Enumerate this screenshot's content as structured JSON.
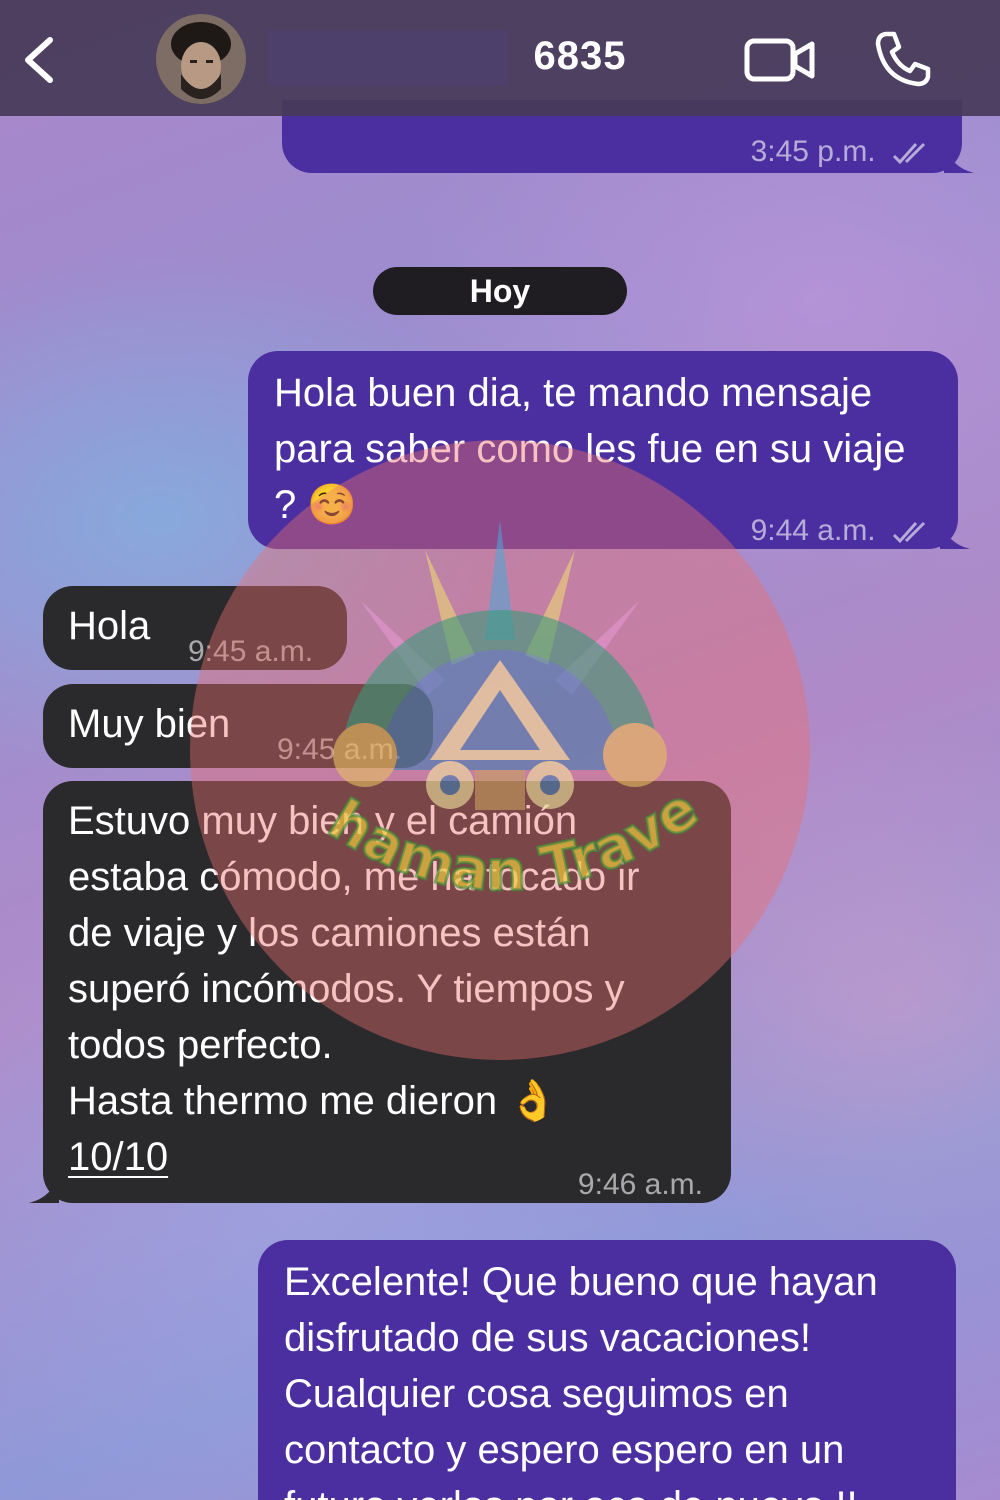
{
  "header": {
    "contact_name": "6835",
    "back_icon": "chevron-left-icon",
    "video_icon": "video-camera-icon",
    "phone_icon": "phone-icon"
  },
  "date_divider": "Hoy",
  "messages": [
    {
      "direction": "outgoing",
      "text": "",
      "time": "3:45 p.m.",
      "status": "read"
    },
    {
      "direction": "outgoing",
      "text": "Hola buen dia, te mando mensaje para saber como les fue en su viaje ? ☺️",
      "time": "9:44 a.m.",
      "status": "read"
    },
    {
      "direction": "incoming",
      "text": "Hola",
      "time": "9:45 a.m."
    },
    {
      "direction": "incoming",
      "text": "Muy bien",
      "time": "9:45 a.m."
    },
    {
      "direction": "incoming",
      "text_lines": [
        "Estuvo muy bien y el camión",
        "estaba cómodo, me ha tocado ir",
        "de viaje y los camiones están",
        "superó incómodos. Y tiempos y",
        "todos perfecto.",
        "Hasta thermo me dieron 👌"
      ],
      "link_text": "10/10",
      "time": "9:46 a.m."
    },
    {
      "direction": "outgoing",
      "text_lines": [
        "Excelente! Que bueno que hayan",
        "disfrutado de sus vacaciones!",
        "Cualquier cosa seguimos en",
        "contacto y espero espero en un",
        "futuro verlos por aca de nuevo !!"
      ]
    }
  ],
  "watermark": {
    "brand_text": "Shaman Travel"
  },
  "colors": {
    "outgoing_bubble": "#4b2fa0",
    "incoming_bubble": "#2a2a2c",
    "header_bg": "#463a58"
  }
}
